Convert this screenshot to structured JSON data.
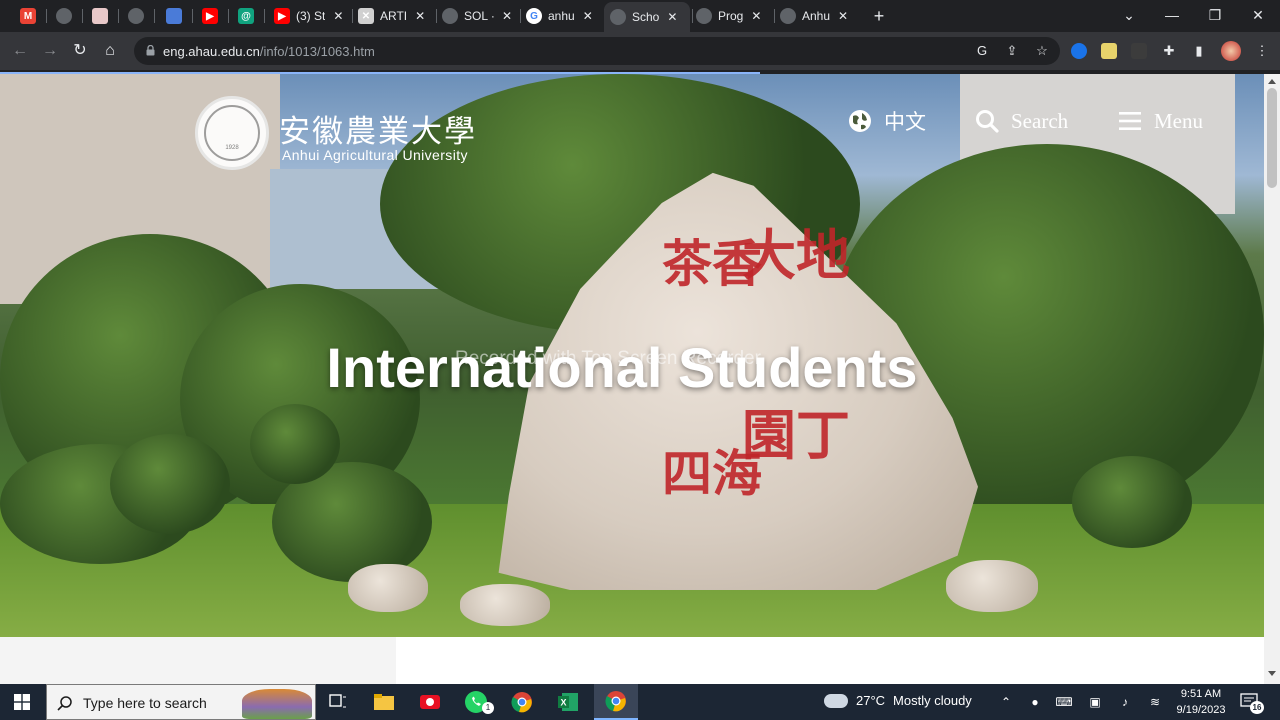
{
  "browser": {
    "tabs": [
      {
        "title": "",
        "icon": "gmail-icon",
        "color": "#ea4335",
        "letter": "M"
      },
      {
        "title": "",
        "icon": "globe-icon",
        "color": "#5f6368",
        "letter": ""
      },
      {
        "title": "",
        "icon": "doc-icon",
        "color": "#e8c8c8",
        "letter": ""
      },
      {
        "title": "",
        "icon": "globe-icon",
        "color": "#5f6368",
        "letter": ""
      },
      {
        "title": "",
        "icon": "meet-icon",
        "color": "#4a7bd8",
        "letter": ""
      },
      {
        "title": "",
        "icon": "youtube-icon",
        "color": "#ff0000",
        "letter": "▶"
      },
      {
        "title": "",
        "icon": "chatgpt-icon",
        "color": "#10a37f",
        "letter": "@"
      },
      {
        "title": "(3) St",
        "icon": "youtube-icon",
        "color": "#ff0000",
        "letter": "▶"
      },
      {
        "title": "ARTI",
        "icon": "article-icon",
        "color": "#d0d0d0",
        "letter": "✕"
      },
      {
        "title": "SOL ·",
        "icon": "globe-icon",
        "color": "#5f6368",
        "letter": ""
      },
      {
        "title": "anhu",
        "icon": "google-icon",
        "color": "#ffffff",
        "letter": "G"
      },
      {
        "title": "Scho",
        "icon": "globe-icon",
        "color": "#5f6368",
        "letter": ""
      },
      {
        "title": "Prog",
        "icon": "globe-icon",
        "color": "#5f6368",
        "letter": ""
      },
      {
        "title": "Anhu",
        "icon": "globe-icon",
        "color": "#5f6368",
        "letter": ""
      }
    ],
    "active_tab_index": 11,
    "new_tab_label": "+",
    "url_host": "eng.ahau.edu.cn",
    "url_path": "/info/1013/1063.htm"
  },
  "site": {
    "logo_cn": "安徽農業大學",
    "logo_en": "Anhui Agricultural University",
    "seal_year": "1928",
    "lang_label": "中文",
    "search_label": "Search",
    "menu_label": "Menu",
    "hero_title": "International Students",
    "watermark": "Recorded with Top Screen Recorder",
    "rock_text": [
      "大地",
      "園丁",
      "茶香",
      "四海"
    ]
  },
  "taskbar": {
    "search_placeholder": "Type here to search",
    "weather_temp": "27°C",
    "weather_desc": "Mostly cloudy",
    "time": "9:51 AM",
    "date": "9/19/2023",
    "notification_count": "16",
    "whatsapp_badge": "1"
  },
  "colors": {
    "accent": "#8ab4f8",
    "taskbar": "#1c2634",
    "chrome_dark": "#202124"
  }
}
